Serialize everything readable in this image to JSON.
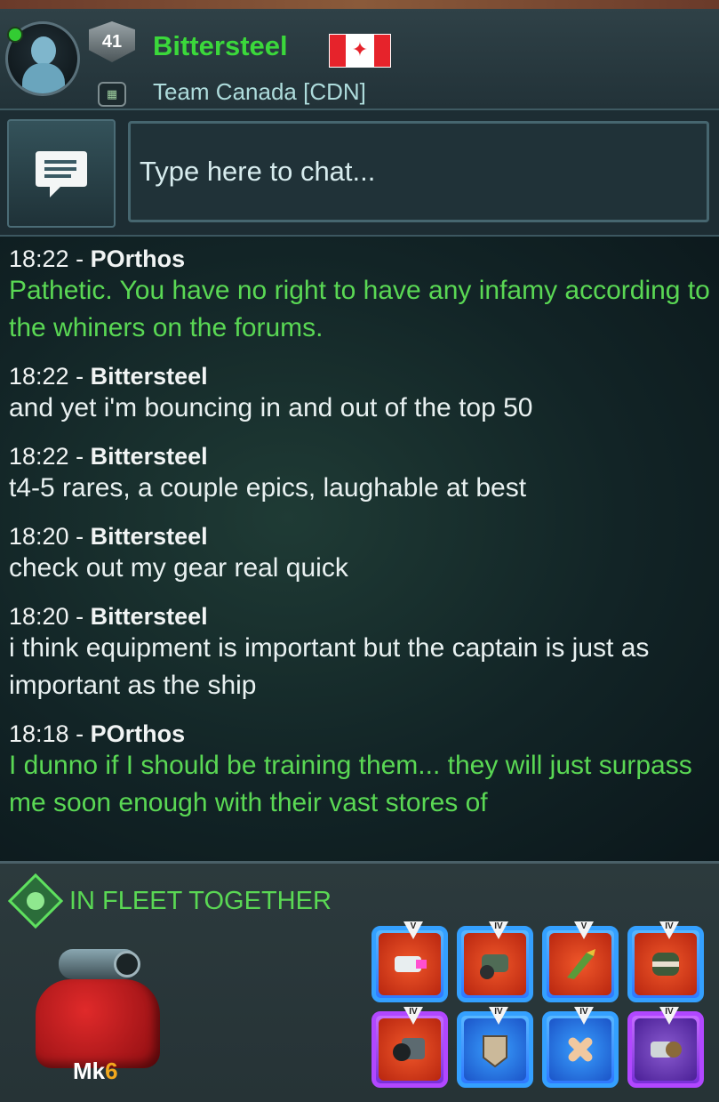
{
  "profile": {
    "level": "41",
    "player_name": "Bittersteel",
    "team_name": "Team Canada [CDN]",
    "online": true,
    "flag": "canada-flag-icon"
  },
  "chat": {
    "placeholder": "Type here to chat..."
  },
  "messages": [
    {
      "time": "18:22",
      "sender": "POrthos",
      "text": "Pathetic. You have no right to have any infamy according to the whiners on the forums.",
      "color": "green"
    },
    {
      "time": "18:22",
      "sender": "Bittersteel",
      "text": "and yet i'm bouncing in and out of the top 50",
      "color": "white"
    },
    {
      "time": "18:22",
      "sender": "Bittersteel",
      "text": "t4-5 rares, a couple epics, laughable at best",
      "color": "white"
    },
    {
      "time": "18:20",
      "sender": "Bittersteel",
      "text": "check out my gear real quick",
      "color": "white"
    },
    {
      "time": "18:20",
      "sender": "Bittersteel",
      "text": "i think equipment is important but the captain is just as important as the ship",
      "color": "white"
    },
    {
      "time": "18:18",
      "sender": "POrthos",
      "text": "I dunno if I should be training them... they will just surpass me soon enough with their vast stores of",
      "color": "green"
    }
  ],
  "fleet": {
    "label": "IN FLEET TOGETHER",
    "ship_mk_prefix": "Mk",
    "ship_mk_number": "6"
  },
  "gear": [
    {
      "tier": "V",
      "icon": "laser-cannon-icon",
      "frame": "blue"
    },
    {
      "tier": "IV",
      "icon": "missile-launcher-icon",
      "frame": "blue"
    },
    {
      "tier": "V",
      "icon": "rocket-icon",
      "frame": "blue"
    },
    {
      "tier": "IV",
      "icon": "mine-icon",
      "frame": "blue"
    },
    {
      "tier": "IV",
      "icon": "heavy-cannon-icon",
      "frame": "purple"
    },
    {
      "tier": "IV",
      "icon": "armor-plate-icon",
      "frame": "blue"
    },
    {
      "tier": "IV",
      "icon": "repair-bandage-icon",
      "frame": "blue"
    },
    {
      "tier": "IV",
      "icon": "engine-icon",
      "frame": "purple"
    }
  ],
  "colors": {
    "player_name": "#3bd83b",
    "green_text": "#5ad854",
    "orange_number": "#f2a81d"
  }
}
